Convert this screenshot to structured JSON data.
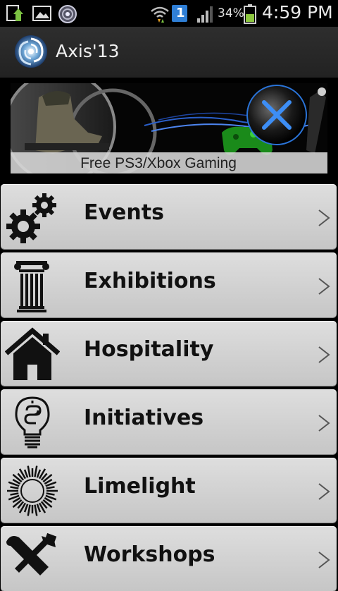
{
  "status_bar": {
    "battery_percent": "34%",
    "time": "4:59 PM",
    "notification_badge": "1",
    "icons": [
      "upload-icon",
      "image-icon",
      "app-notification-icon",
      "wifi-icon",
      "notification-badge-icon",
      "signal-icon",
      "battery-icon"
    ]
  },
  "app_bar": {
    "title": "Axis'13",
    "logo_icon": "swirl-logo-icon"
  },
  "banner": {
    "caption": "Free PS3/Xbox Gaming"
  },
  "menu": {
    "items": [
      {
        "label": "Events",
        "icon": "gears-icon"
      },
      {
        "label": "Exhibitions",
        "icon": "pillar-icon"
      },
      {
        "label": "Hospitality",
        "icon": "house-icon"
      },
      {
        "label": "Initiatives",
        "icon": "lightbulb-icon"
      },
      {
        "label": "Limelight",
        "icon": "sunburst-icon"
      },
      {
        "label": "Workshops",
        "icon": "tools-icon"
      }
    ]
  },
  "colors": {
    "background": "#000000",
    "menu_item": "#d3d3d3",
    "battery_fill": "#8cc63f"
  }
}
